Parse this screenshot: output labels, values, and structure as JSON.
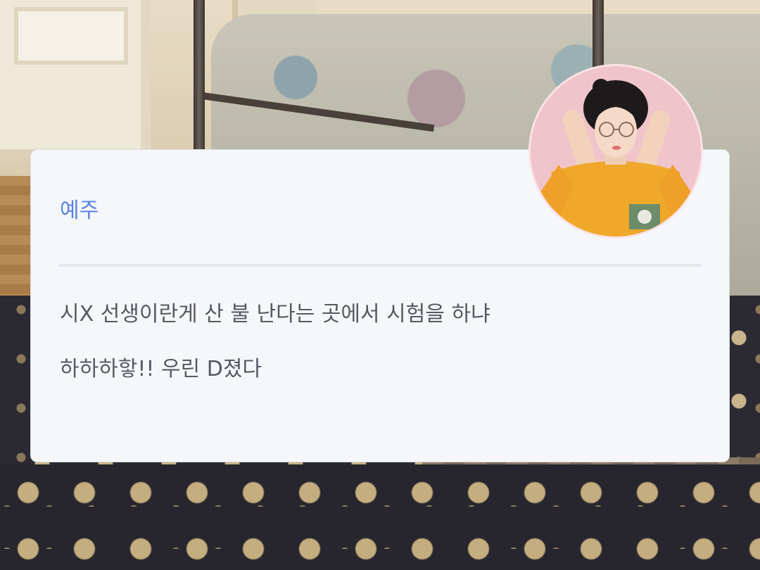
{
  "message_card": {
    "sender_name": "예주",
    "message_lines": [
      "시X 선생이란게 산 불 난다는 곳에서 시험을 하냐",
      "하하하핳!! 우린 D졌다"
    ]
  },
  "avatar": {
    "icon": "profile-photo-avatar"
  },
  "colors": {
    "name_accent": "#5b84e6",
    "card_background": "#f5f7fa",
    "body_text": "#555a63"
  }
}
